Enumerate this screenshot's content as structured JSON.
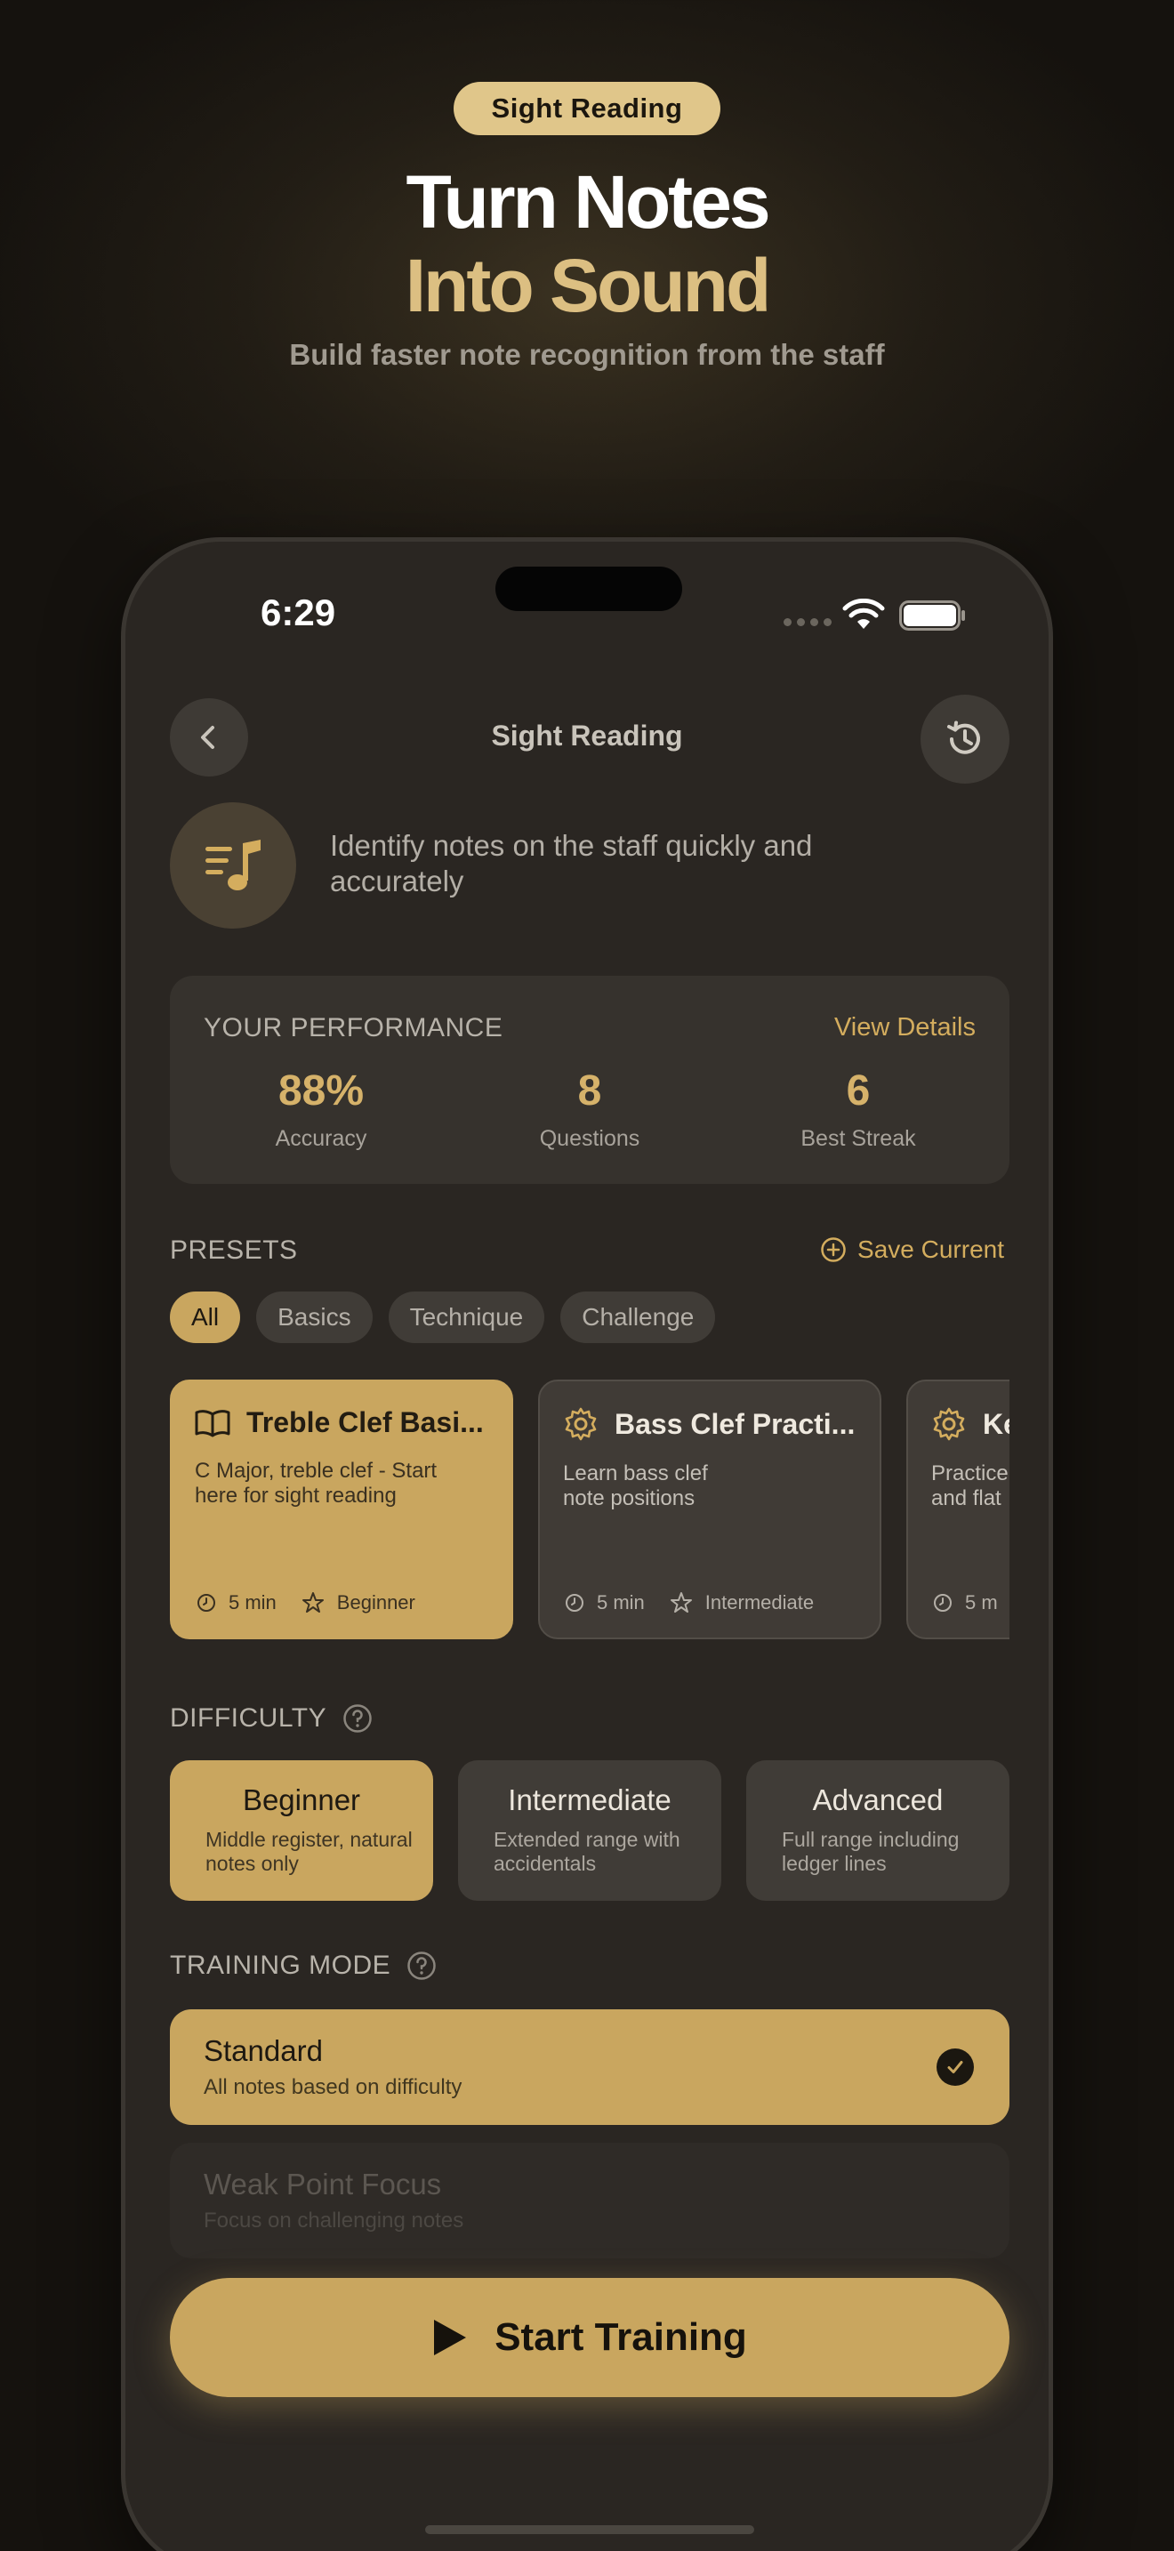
{
  "hero": {
    "badge": "Sight Reading",
    "title_line1": "Turn Notes",
    "title_line2": "Into Sound",
    "subtitle": "Build faster note recognition from the staff"
  },
  "status_bar": {
    "time": "6:29"
  },
  "nav": {
    "title": "Sight Reading",
    "back_icon": "chevron-left-icon",
    "history_icon": "history-icon"
  },
  "intro": {
    "icon": "music-notes-list-icon",
    "text": "Identify notes on the staff quickly and accurately"
  },
  "performance": {
    "label": "YOUR PERFORMANCE",
    "link": "View Details",
    "stats": [
      {
        "value": "88%",
        "label": "Accuracy"
      },
      {
        "value": "8",
        "label": "Questions"
      },
      {
        "value": "6",
        "label": "Best Streak"
      }
    ]
  },
  "presets": {
    "label": "PRESETS",
    "save_label": "Save Current",
    "filters": [
      "All",
      "Basics",
      "Technique",
      "Challenge"
    ],
    "active_filter": "All",
    "cards": [
      {
        "title": "Treble Clef Basi...",
        "description": "C Major, treble clef - Start here for sight reading",
        "duration": "5 min",
        "level": "Beginner",
        "icon": "book-icon",
        "selected": true
      },
      {
        "title": "Bass Clef Practi...",
        "description": "Learn bass clef note positions",
        "duration": "5 min",
        "level": "Intermediate",
        "icon": "gear-icon",
        "selected": false
      },
      {
        "title": "Ke",
        "description": "Practice and flat",
        "duration": "5 m",
        "level": "",
        "icon": "gear-icon",
        "selected": false
      }
    ]
  },
  "difficulty": {
    "label": "DIFFICULTY",
    "options": [
      {
        "title": "Beginner",
        "description": "Middle register, natural notes only",
        "active": true
      },
      {
        "title": "Intermediate",
        "description": "Extended range with accidentals",
        "active": false
      },
      {
        "title": "Advanced",
        "description": "Full range including ledger lines",
        "active": false
      }
    ]
  },
  "training_mode": {
    "label": "TRAINING MODE",
    "options": [
      {
        "title": "Standard",
        "description": "All notes based on difficulty",
        "selected": true
      },
      {
        "title": "Weak Point Focus",
        "description": "Focus on challenging notes",
        "selected": false
      }
    ]
  },
  "start_button": {
    "label": "Start Training"
  },
  "colors": {
    "accent": "#c9a65f",
    "background": "#2a2622",
    "card": "#403c37"
  }
}
